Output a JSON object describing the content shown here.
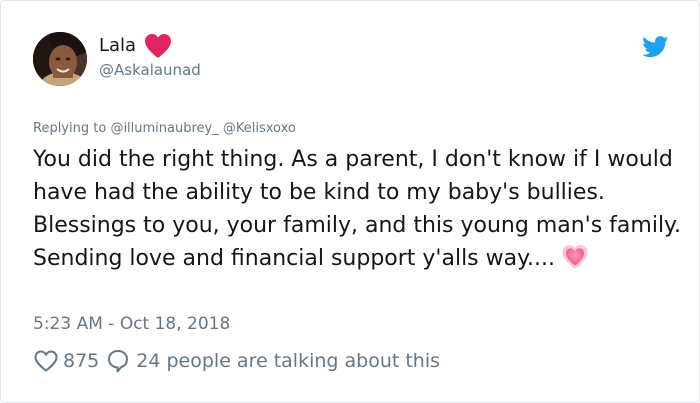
{
  "author": {
    "display_name": "Lala",
    "handle": "@Askalaunad"
  },
  "reply_context": {
    "prefix": "Replying to ",
    "mention1": "@illuminaubrey_",
    "mention2": "@Kelisxoxo"
  },
  "tweet": {
    "text": "You did the right thing. As a parent, I don't know if I would have had the ability to be kind to my baby's bullies. Blessings to you, your family, and this young man's family.   Sending love and financial support y'alls way...."
  },
  "meta": {
    "timestamp": "5:23 AM - Oct 18, 2018",
    "like_count": "875",
    "talking_text": "24 people are talking about this"
  },
  "colors": {
    "text_primary": "#14171a",
    "text_secondary": "#657786",
    "twitter_blue": "#1da1f2",
    "heart_red": "#e0245e",
    "border": "#e1e8ed"
  },
  "icons": {
    "author_badge": "red-heart-icon",
    "brand": "twitter-bird-icon",
    "emoji": "sparkling-heart-icon",
    "like": "heart-outline-icon",
    "reply": "speech-bubble-icon"
  }
}
